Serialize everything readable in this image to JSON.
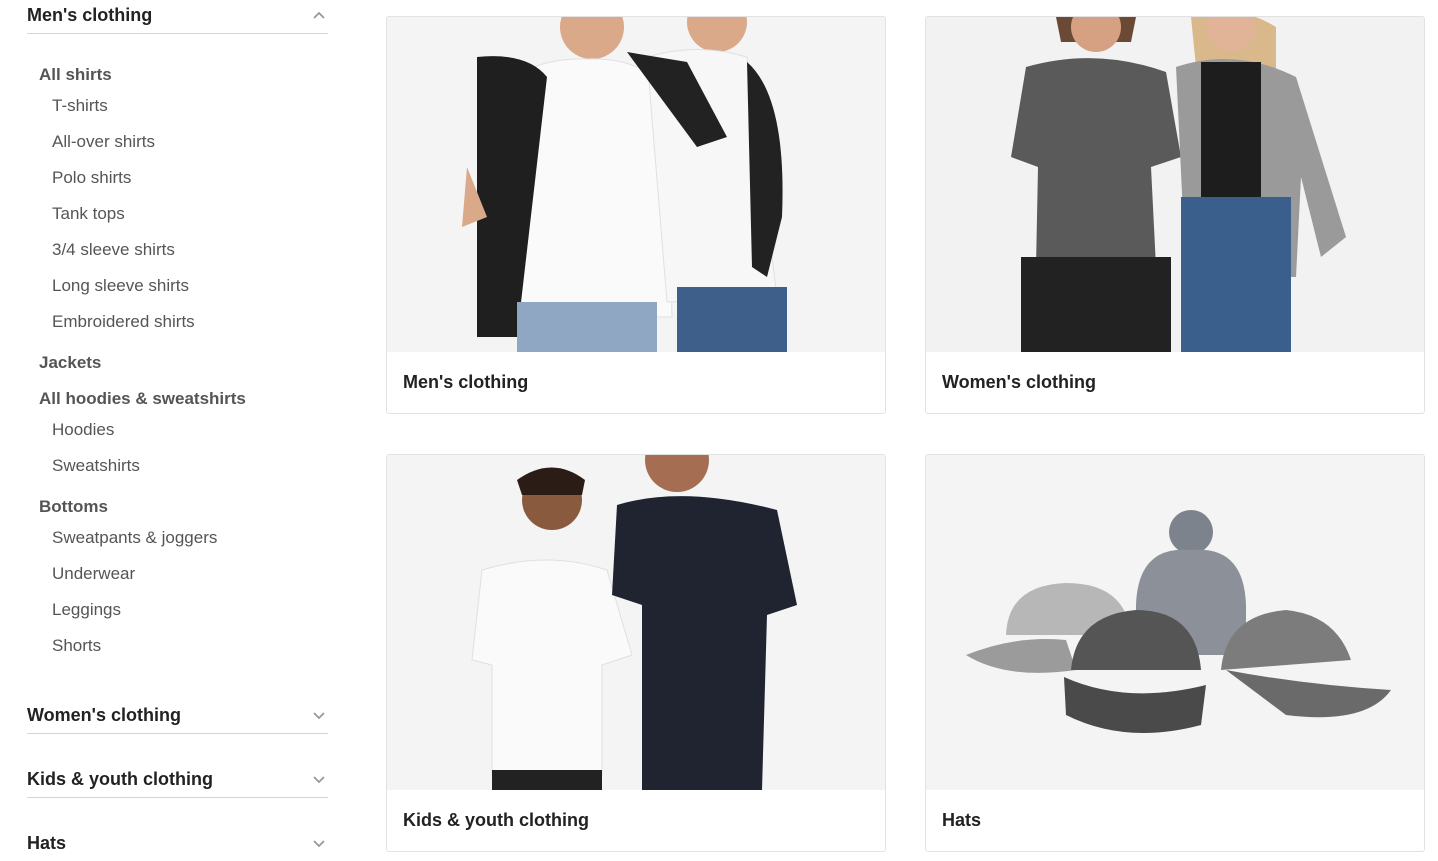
{
  "sidebar": {
    "mens": {
      "title": "Men's clothing",
      "groups": {
        "all_shirts": "All shirts",
        "jackets": "Jackets",
        "hoodies_sweatshirts": "All hoodies & sweatshirts",
        "bottoms": "Bottoms"
      },
      "items": {
        "tshirts": "T-shirts",
        "allover": "All-over shirts",
        "polo": "Polo shirts",
        "tank": "Tank tops",
        "three_quarter": "3/4 sleeve shirts",
        "long_sleeve": "Long sleeve shirts",
        "embroidered": "Embroidered shirts",
        "hoodies": "Hoodies",
        "sweatshirts": "Sweatshirts",
        "sweatpants": "Sweatpants & joggers",
        "underwear": "Underwear",
        "leggings": "Leggings",
        "shorts": "Shorts"
      }
    },
    "womens": "Women's clothing",
    "kids": "Kids & youth clothing",
    "hats": "Hats"
  },
  "cards": {
    "mens": "Men's clothing",
    "womens": "Women's clothing",
    "kids": "Kids & youth clothing",
    "hats": "Hats"
  },
  "icons": {
    "expanded": "chevron-up-icon",
    "collapsed": "chevron-down-icon"
  }
}
